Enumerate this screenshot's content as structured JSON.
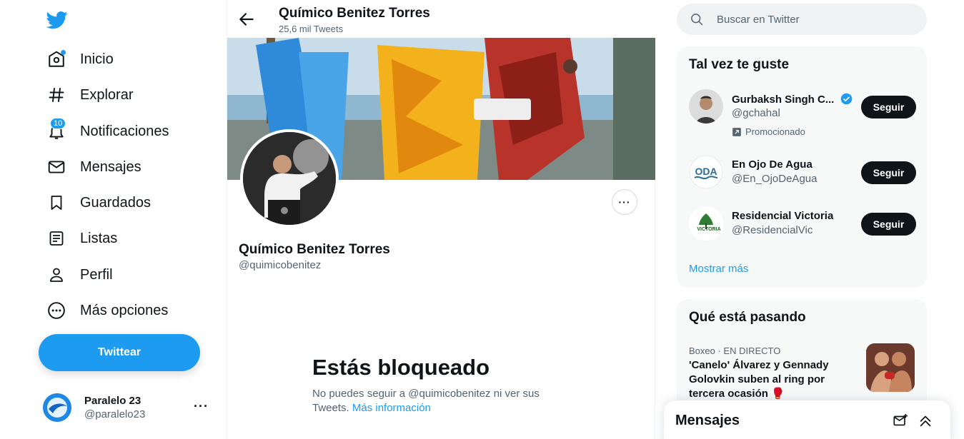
{
  "sidebar": {
    "items": [
      {
        "label": "Inicio"
      },
      {
        "label": "Explorar"
      },
      {
        "label": "Notificaciones",
        "badge": "10"
      },
      {
        "label": "Mensajes"
      },
      {
        "label": "Guardados"
      },
      {
        "label": "Listas"
      },
      {
        "label": "Perfil"
      },
      {
        "label": "Más opciones"
      }
    ],
    "tweet_button": "Twittear",
    "account": {
      "name": "Paralelo 23",
      "handle": "@paralelo23",
      "more": "···"
    }
  },
  "header": {
    "title": "Químico Benitez Torres",
    "subtitle": "25,6 mil Tweets"
  },
  "profile": {
    "name": "Químico Benitez Torres",
    "handle": "@quimicobenitez",
    "more": "···"
  },
  "blocked": {
    "title": "Estás bloqueado",
    "text": "No puedes seguir a @quimicobenitez ni ver sus Tweets.",
    "link": "Más información"
  },
  "search": {
    "placeholder": "Buscar en Twitter"
  },
  "who_to_follow": {
    "title": "Tal vez te guste",
    "items": [
      {
        "name": "Gurbaksh Singh C...",
        "handle": "@gchahal",
        "promo": "Promocionado",
        "follow": "Seguir"
      },
      {
        "name": "En Ojo De Agua",
        "handle": "@En_OjoDeAgua",
        "follow": "Seguir"
      },
      {
        "name": "Residencial Victoria",
        "handle": "@ResidencialVic",
        "follow": "Seguir"
      }
    ],
    "show_more": "Mostrar más"
  },
  "trends": {
    "title": "Qué está pasando",
    "meta": "Boxeo · EN DIRECTO",
    "text": "'Canelo' Álvarez y Gennady Golovkin suben al ring por tercera ocasión 🥊"
  },
  "messages_drawer": {
    "title": "Mensajes"
  },
  "colors": {
    "accent": "#1d9bf0",
    "text": "#0f1419",
    "secondary": "#536471"
  }
}
